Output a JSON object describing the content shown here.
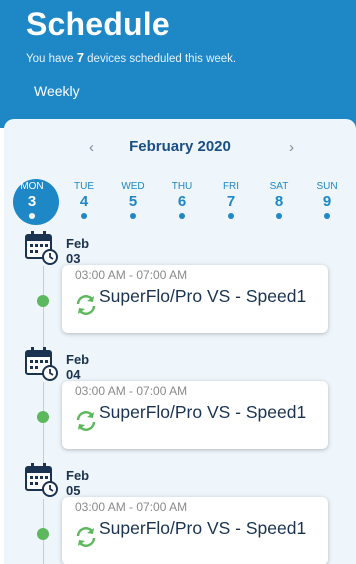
{
  "header": {
    "title": "Schedule",
    "subtitle_prefix": "You have ",
    "device_count": "7",
    "subtitle_suffix": " devices scheduled this week.",
    "tab_label": "Weekly"
  },
  "calendar": {
    "month_label": "February 2020",
    "prev_icon": "‹",
    "next_icon": "›",
    "days": [
      {
        "name": "MON",
        "num": "3",
        "selected": true
      },
      {
        "name": "TUE",
        "num": "4"
      },
      {
        "name": "WED",
        "num": "5"
      },
      {
        "name": "THU",
        "num": "6"
      },
      {
        "name": "FRI",
        "num": "7"
      },
      {
        "name": "SAT",
        "num": "8"
      },
      {
        "name": "SUN",
        "num": "9"
      }
    ]
  },
  "events": [
    {
      "date": "Feb 03",
      "time": "03:00 AM - 07:00 AM",
      "name": "SuperFlo/Pro VS - Speed1"
    },
    {
      "date": "Feb 04",
      "time": "03:00 AM - 07:00 AM",
      "name": "SuperFlo/Pro VS - Speed1"
    },
    {
      "date": "Feb 05",
      "time": "03:00 AM - 07:00 AM",
      "name": "SuperFlo/Pro VS - Speed1"
    }
  ],
  "colors": {
    "brand_blue": "#1e88c7",
    "panel_bg": "#eef5fb",
    "month_text": "#1a4f86",
    "active_green": "#5cb85c"
  },
  "icons": {
    "calendar": "calendar-clock-icon",
    "sync": "sync-icon",
    "timeline_dot": "status-dot-icon"
  }
}
